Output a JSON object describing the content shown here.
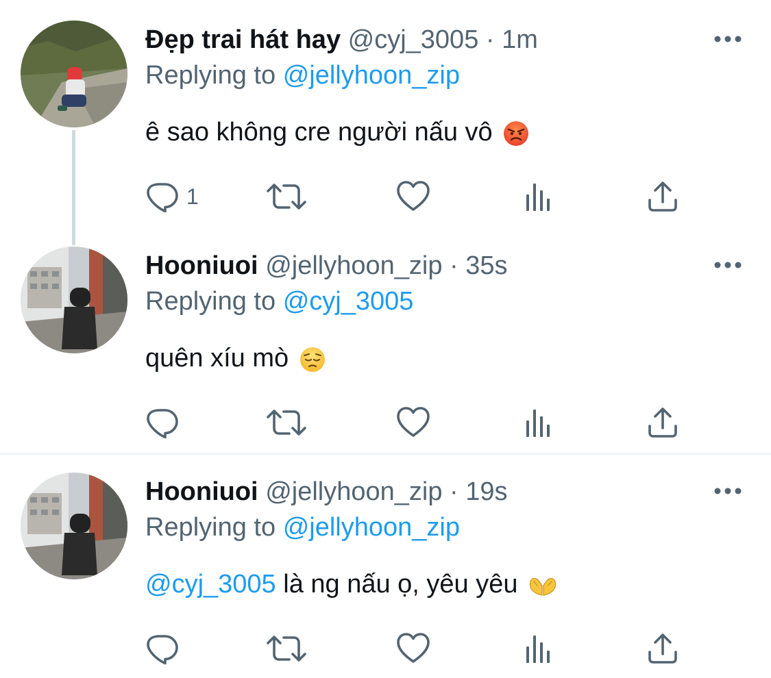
{
  "tweets": [
    {
      "display_name": "Đẹp trai hát hay",
      "handle": "@cyj_3005",
      "separator": "·",
      "time": "1m",
      "replying_prefix": "Replying to",
      "replying_to": "@jellyhoon_zip",
      "text": "ê sao không cre người nấu vô",
      "emoji": "angry-face-emoji",
      "reply_count": "1"
    },
    {
      "display_name": "Hooniuoi",
      "handle": "@jellyhoon_zip",
      "separator": "·",
      "time": "35s",
      "replying_prefix": "Replying to",
      "replying_to": "@cyj_3005",
      "text": "quên xíu mò",
      "emoji": "pensive-face-emoji",
      "reply_count": ""
    },
    {
      "display_name": "Hooniuoi",
      "handle": "@jellyhoon_zip",
      "separator": "·",
      "time": "19s",
      "replying_prefix": "Replying to",
      "replying_to": "@jellyhoon_zip",
      "mention": "@cyj_3005",
      "text": "là ng nấu ọ, yêu yêu",
      "emoji": "heart-hands-emoji",
      "reply_count": ""
    }
  ],
  "colors": {
    "link": "#1d9bf0",
    "secondary_text": "#536471",
    "primary_text": "#0f1419",
    "icon": "#536471"
  },
  "icons": [
    "more-icon",
    "reply-icon",
    "retweet-icon",
    "like-icon",
    "analytics-icon",
    "share-icon"
  ]
}
